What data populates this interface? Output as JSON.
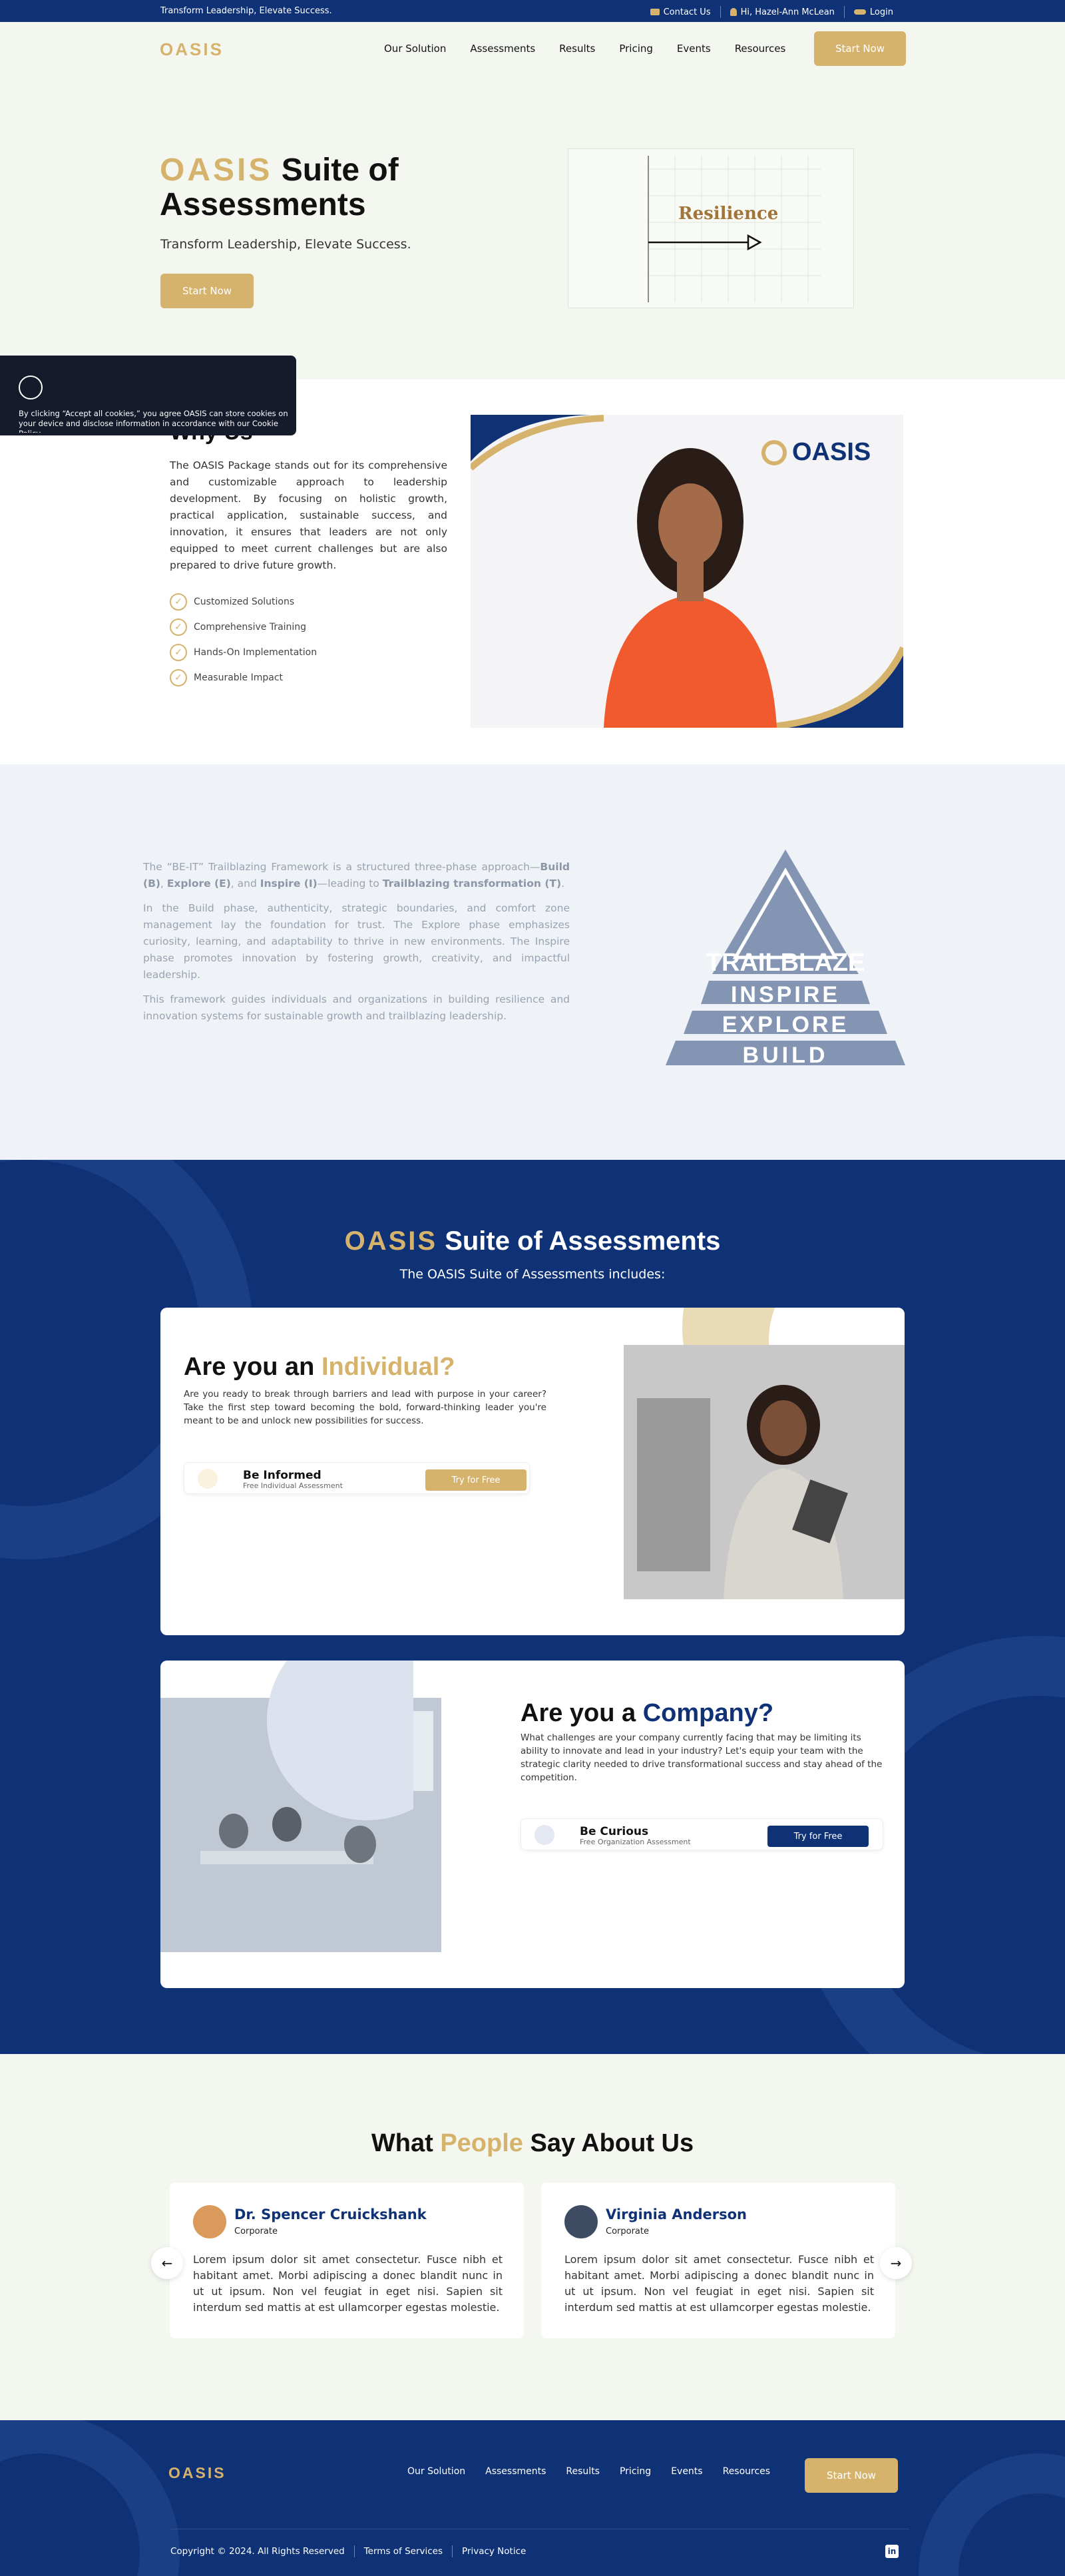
{
  "topbar": {
    "tagline": "Transform Leadership, Elevate Success.",
    "contact": "Contact Us",
    "greeting": "Hi, Hazel-Ann McLean",
    "login": "Login"
  },
  "header": {
    "logo": "OASIS",
    "nav": [
      "Our Solution",
      "Assessments",
      "Results",
      "Pricing",
      "Events",
      "Resources"
    ],
    "cta": "Start Now"
  },
  "hero": {
    "title_brand": "OASIS",
    "title_rest": "Suite of Assessments",
    "subtitle": "Transform Leadership, Elevate Success.",
    "cta": "Start Now",
    "chart_word": "Resilience"
  },
  "cookie": {
    "text": "By clicking “Accept all cookies,” you agree OASIS can store cookies on your device and disclose information in accordance with our Cookie Policy."
  },
  "why": {
    "title": "Why Us",
    "body": "The OASIS Package stands out for its comprehensive and customizable approach to leadership development. By focusing on holistic growth, practical application, sustainable success, and innovation, it ensures that leaders are not only equipped to meet current challenges but are also prepared to drive future growth.",
    "features": [
      "Customized Solutions",
      "Comprehensive Training",
      "Hands-On Implementation",
      "Measurable Impact"
    ],
    "photo_logo": "OASIS"
  },
  "trail": {
    "p1_a": "The “BE-IT” Trailblazing Framework is a structured three-phase approach—",
    "p1_b": "Build (B)",
    "p1_c": ", ",
    "p1_d": "Explore (E)",
    "p1_e": ", and ",
    "p1_f": "Inspire (I)",
    "p1_g": "—leading to ",
    "p1_h": "Trailblazing transformation (T)",
    "p1_i": ".",
    "p2": "In the Build phase, authenticity, strategic boundaries, and comfort zone management lay the foundation for trust. The Explore phase emphasizes curiosity, learning, and adaptability to thrive in new environments. The Inspire phase promotes innovation by fostering growth, creativity, and impactful leadership.",
    "p3": "This framework guides individuals and organizations in building resilience and innovation systems for sustainable growth and trailblazing leadership.",
    "pyramid": [
      "TRAILBLAZE",
      "INSPIRE",
      "EXPLORE",
      "BUILD"
    ]
  },
  "suite": {
    "title_brand": "OASIS",
    "title_rest": "Suite of Assessments",
    "intro": "The OASIS Suite of Assessments includes:",
    "individual": {
      "q_a": "Are you an ",
      "q_b": "Individual?",
      "desc": "Are you ready to break through barriers and lead with purpose in your career? Take the first step toward becoming the bold, forward-thinking leader you're meant to be and unlock new possibilities for success.",
      "pill_title": "Be Informed",
      "pill_sub": "Free Individual Assessment",
      "pill_btn": "Try for Free"
    },
    "company": {
      "q_a": "Are you a ",
      "q_b": "Company?",
      "desc": "What challenges are your company currently facing that may be limiting its ability to innovate and lead in your industry? Let's equip your team with the strategic clarity needed to drive transformational success and stay ahead of the competition.",
      "pill_title": "Be Curious",
      "pill_sub": "Free Organization Assessment",
      "pill_btn": "Try for Free"
    }
  },
  "testimonials": {
    "title_a": "What ",
    "title_b": "People",
    "title_c": " Say About Us",
    "items": [
      {
        "name": "Dr. Spencer Cruickshank",
        "role": "Corporate",
        "quote": "Lorem ipsum dolor sit amet consectetur. Fusce nibh et habitant amet. Morbi adipiscing a donec blandit nunc in ut ut ipsum. Non vel feugiat in eget nisi. Sapien sit interdum sed mattis at est ullamcorper egestas molestie."
      },
      {
        "name": "Virginia Anderson",
        "role": "Corporate",
        "quote": "Lorem ipsum dolor sit amet consectetur. Fusce nibh et habitant amet. Morbi adipiscing a donec blandit nunc in ut ut ipsum. Non vel feugiat in eget nisi. Sapien sit interdum sed mattis at est ullamcorper egestas molestie."
      }
    ]
  },
  "footer": {
    "logo": "OASIS",
    "nav": [
      "Our Solution",
      "Assessments",
      "Results",
      "Pricing",
      "Events",
      "Resources"
    ],
    "cta": "Start Now",
    "copyright": "Copyright © 2024. All Rights Reserved",
    "terms": "Terms of Services",
    "privacy": "Privacy Notice",
    "social": "in"
  },
  "colors": {
    "navy": "#0f3276",
    "gold": "#d6b36c",
    "mint": "#f3f7f0"
  }
}
